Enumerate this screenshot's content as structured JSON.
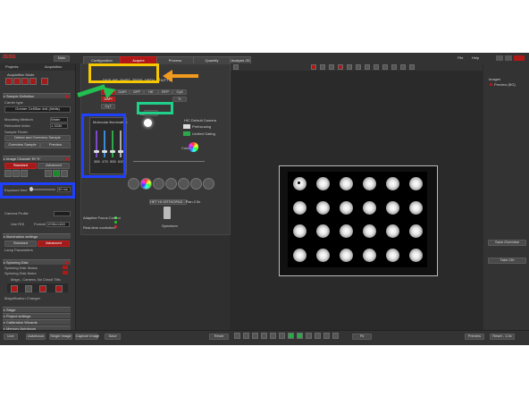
{
  "app": {
    "logo": "ZEISS"
  },
  "top_bar": {
    "left_btn": "Main",
    "tabs": [
      "Configuration",
      "Acquire",
      "Process",
      "Quantify",
      "Analysis 2D"
    ],
    "right_items": [
      "File",
      "Help"
    ]
  },
  "left": {
    "tabs": [
      "Projects",
      "Acquisition"
    ],
    "acq_mode": "Acquisition Mode",
    "sample": {
      "title": "Sample Definition",
      "carrier_label": "Carrier type",
      "carrier": "Greiner CellStar 4x6 (Wells)",
      "mounting_label": "Mounting Medium",
      "mounting": "Water",
      "ri_label": "Refractive index",
      "ri": "1.3330",
      "finder_label": "Sample Finder",
      "btn_detect": "Detect and Overview Sample",
      "btn_overview": "Overview Sample",
      "btn_preview": "Preview"
    },
    "image": {
      "title": "Image Channel 'B+Tr'",
      "btn_standard": "Standard",
      "btn_advanced": "Advanced",
      "exposure_label": "Exposure time",
      "exposure": "40 ms",
      "camera_label": "Camera Profile",
      "use_roi": "Use ROI",
      "format": "Format",
      "format_val": "1936x1460"
    },
    "illum": {
      "title": "Illumination settings",
      "btn_standard": "Standard",
      "btn_advanced": "Advanced",
      "lamp": "Lamp Parameters"
    },
    "spin": {
      "title": "Spinning Disk",
      "status": "Spinning Disk Status",
      "motor": "Spinning Disk Motor",
      "filter": "Magn., Camera, No Circuit Tilts",
      "magn": "Magnification Changer"
    },
    "collapsed": [
      "Stage",
      "Project settings",
      "Calibration Wizards",
      "Memory Autofocus"
    ],
    "bottom_btns": [
      "Live",
      "Autofocus",
      "Single Image",
      "Capture image",
      "Save"
    ]
  },
  "center": {
    "address": "DIVE-WF_SHIFT_ZEISS_ORTH_SHUTT D",
    "channels": [
      "BF-1",
      "DAPI",
      "GFP",
      "HE",
      "RFP",
      "Cy5",
      "Cy7",
      "Tr"
    ],
    "mol_title": "Molecular illumination",
    "slider_labels": [
      "385",
      "475",
      "555",
      "630"
    ],
    "lamp_label": "Lamp",
    "cam_title": "HIC Default Camera",
    "cam_items": [
      "Prefocusing",
      "Limited Gating"
    ],
    "color_label": "Colors",
    "nosepiece": "HET HI ORTHOPAS : Plan 2.5x",
    "spec_label": "Specimen",
    "af_rows": [
      "Adaptive Focus Control",
      "Real-time controlled"
    ]
  },
  "viewer": {
    "wells_cols": 6,
    "wells_rows": 4,
    "bottom_btns": [
      "Reset",
      "Fit"
    ],
    "bottom_right": [
      "Preview",
      "Reset - 1.5x"
    ]
  },
  "right": {
    "title": "Images",
    "item": "Preview (BG)",
    "btns": [
      "Save Overview",
      "Take Ctrl"
    ]
  },
  "annotations": {
    "yellow": "#f5c800",
    "orange": "#f29a1f",
    "green": "#22c050",
    "aqua": "#20d08a",
    "blue": "#2040ff"
  }
}
